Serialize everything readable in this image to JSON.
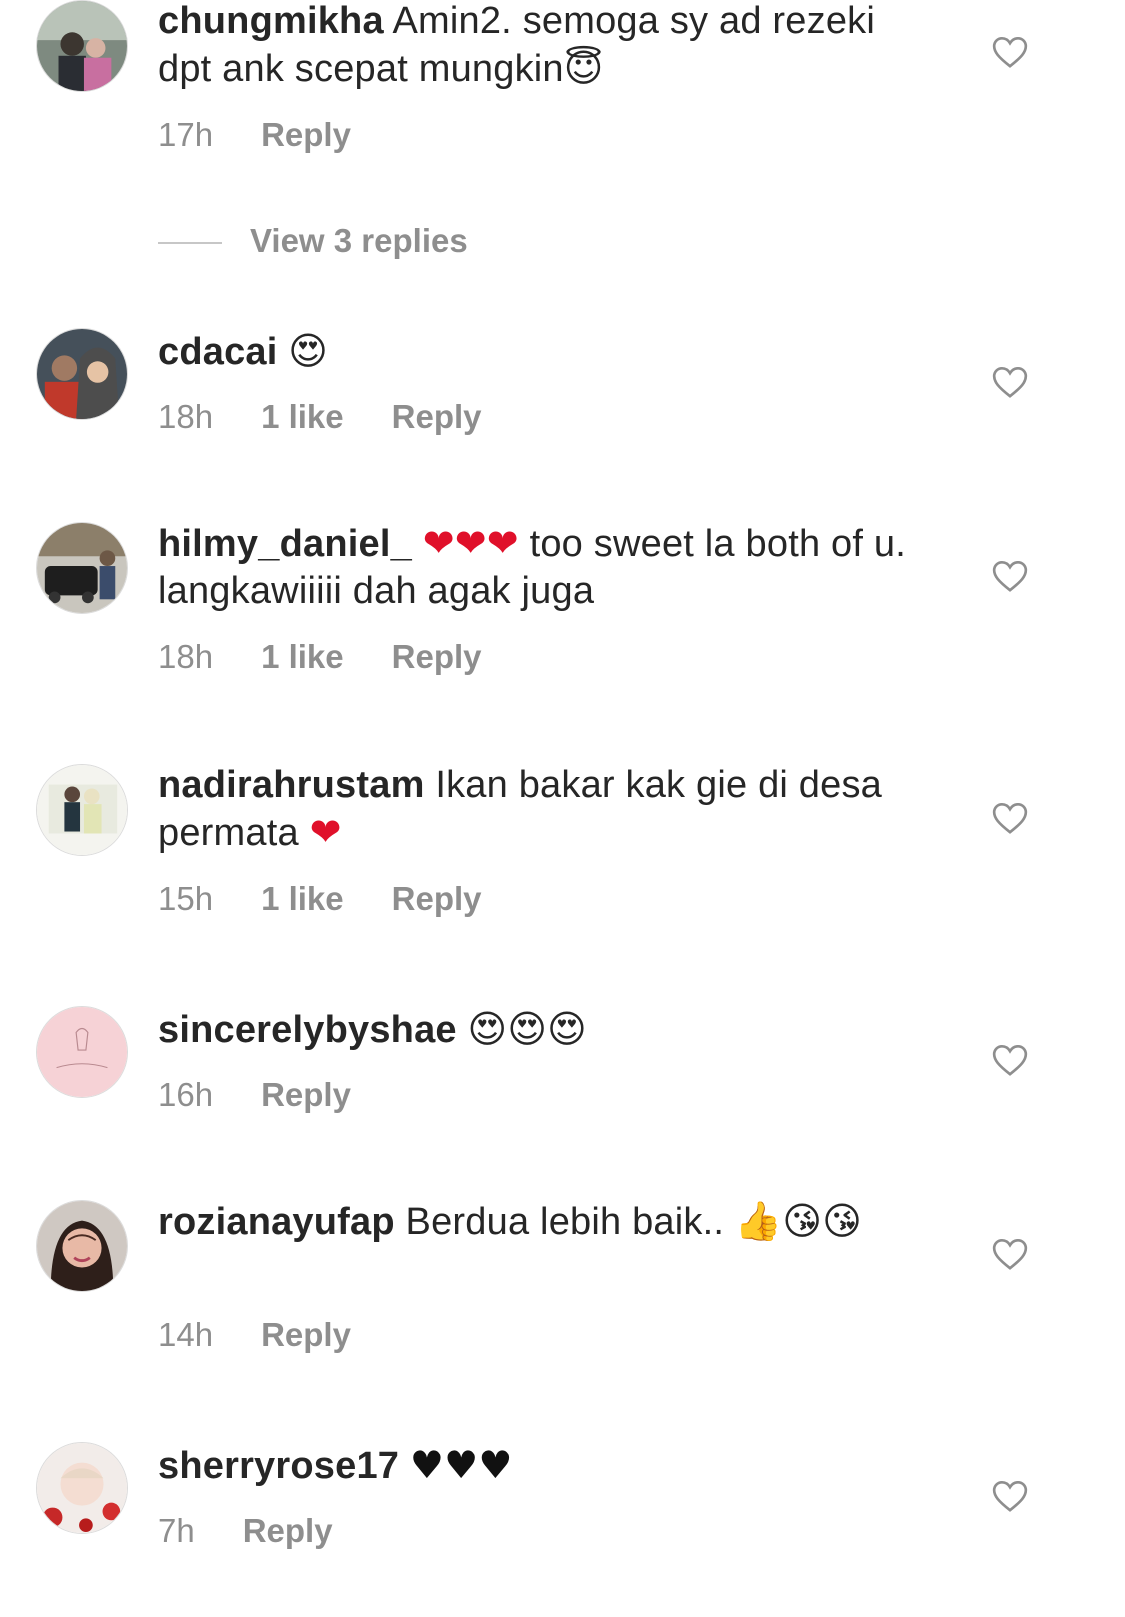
{
  "comments": [
    {
      "username": "chungmikha",
      "text": " Amin2. semoga sy ad rezeki dpt ank scepat mungkin",
      "emoji": "😇",
      "time": "17h",
      "likes": "",
      "reply": "Reply",
      "view_replies": "View 3 replies"
    },
    {
      "username": "cdacai",
      "text": " ",
      "emoji": "😍",
      "time": "18h",
      "likes": "1 like",
      "reply": "Reply"
    },
    {
      "username": "hilmy_daniel_",
      "text_prefix": " ",
      "emoji": "❤❤❤",
      "text": " too sweet la both of u. langkawiiiii dah agak juga",
      "time": "18h",
      "likes": "1 like",
      "reply": "Reply"
    },
    {
      "username": "nadirahrustam",
      "text": " Ikan bakar kak gie di desa permata ",
      "emoji": "❤",
      "time": "15h",
      "likes": "1 like",
      "reply": "Reply"
    },
    {
      "username": "sincerelybyshae",
      "text": " ",
      "emoji": "😍😍😍",
      "time": "16h",
      "likes": "",
      "reply": "Reply"
    },
    {
      "username": "rozianayufap",
      "text": " Berdua lebih baik.. ",
      "emoji": "👍😘😘",
      "time": "14h",
      "likes": "",
      "reply": "Reply"
    },
    {
      "username": "sherryrose17",
      "text": " ",
      "emoji": "♥♥♥",
      "time": "7h",
      "likes": "",
      "reply": "Reply"
    }
  ],
  "icons": {
    "like": "heart-outline-icon"
  },
  "colors": {
    "text": "#262626",
    "meta": "#8e8e8e",
    "heart_emoji": "#e0102a"
  }
}
